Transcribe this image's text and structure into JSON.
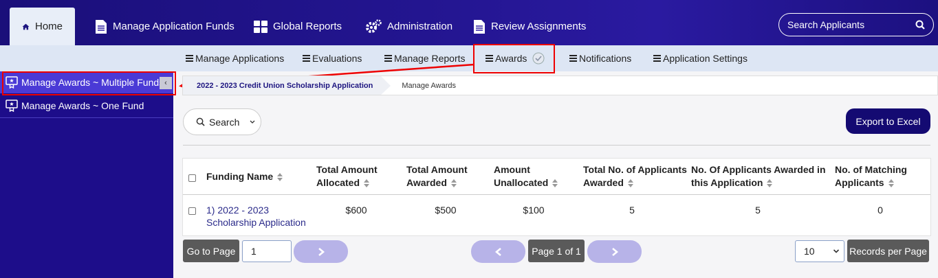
{
  "topnav": {
    "items": [
      {
        "label": "Home",
        "icon": "home-icon"
      },
      {
        "label": "Manage Application Funds",
        "icon": "document-icon"
      },
      {
        "label": "Global Reports",
        "icon": "grid-icon"
      },
      {
        "label": "Administration",
        "icon": "gears-icon"
      },
      {
        "label": "Review Assignments",
        "icon": "document-icon"
      }
    ],
    "search_label": "Search Applicants"
  },
  "subnav": {
    "items": [
      {
        "label": "Manage Applications"
      },
      {
        "label": "Evaluations"
      },
      {
        "label": "Manage Reports"
      },
      {
        "label": "Awards"
      },
      {
        "label": "Notifications"
      },
      {
        "label": "Application Settings"
      }
    ]
  },
  "sidebar": {
    "items": [
      {
        "label": "Manage Awards ~ Multiple Funds"
      },
      {
        "label": "Manage Awards ~ One Fund"
      }
    ]
  },
  "breadcrumb": {
    "first": "2022 - 2023 Credit Union Scholarship Application",
    "second": "Manage Awards"
  },
  "toolbar": {
    "search_label": "Search",
    "export_label": "Export to Excel"
  },
  "table": {
    "headers": {
      "funding_name": "Funding Name",
      "alloc_1": "Total Amount",
      "alloc_2": "Allocated",
      "awarded_1": "Total Amount",
      "awarded_2": "Awarded",
      "unalloc_1": "Amount",
      "unalloc_2": "Unallocated",
      "total_app_1": "Total No. of Applicants",
      "total_app_2": "Awarded",
      "awarded_in_1": "No. Of Applicants Awarded in",
      "awarded_in_2": "this Application",
      "matching_1": "No. of Matching",
      "matching_2": "Applicants"
    },
    "rows": [
      {
        "fund_line1": "1) 2022 - 2023",
        "fund_line2": "Scholarship Application",
        "allocated": "$600",
        "awarded": "$500",
        "unallocated": "$100",
        "total_applicants_awarded": "5",
        "awarded_in_app": "5",
        "matching": "0"
      }
    ]
  },
  "pagination": {
    "goto_label": "Go to Page",
    "page_value": "1",
    "page_info": "Page 1 of 1",
    "per_page_value": "10",
    "records_label": "Records per Page"
  },
  "colors": {
    "nav_dark": "#1d0d8a",
    "accent_button": "#140a72",
    "highlight_red": "#ee0000"
  }
}
